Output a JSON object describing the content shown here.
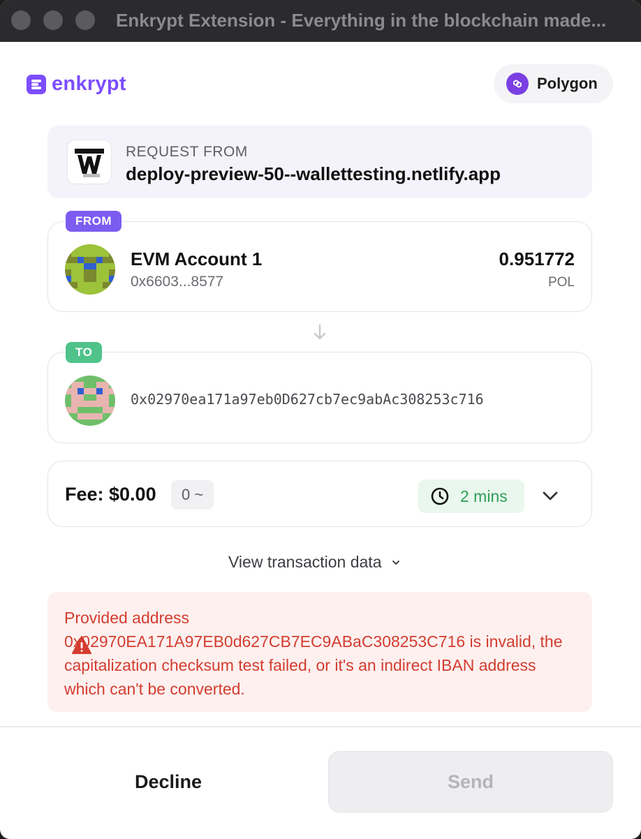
{
  "window": {
    "title": "Enkrypt Extension - Everything in the blockchain made..."
  },
  "header": {
    "logo_text": "enkrypt",
    "network": {
      "name": "Polygon",
      "icon": "polygon-icon"
    }
  },
  "request": {
    "label": "REQUEST FROM",
    "url": "deploy-preview-50--wallettesting.netlify.app",
    "icon": "site-w-icon"
  },
  "from": {
    "tag": "FROM",
    "account_name": "EVM Account 1",
    "address": "0x6603...8577",
    "balance": "0.951772",
    "unit": "POL"
  },
  "to": {
    "tag": "TO",
    "address": "0x02970ea171a97eb0D627cb7ec9abAc308253c716"
  },
  "fee": {
    "label": "Fee: $0.00",
    "native_amount": "0 ~",
    "time": "2 mins"
  },
  "view_tx_label": "View transaction data",
  "error": {
    "message": "Provided address 0x02970EA171A97EB0d627CB7EC9ABaC308253C716 is invalid, the capitalization checksum test failed, or it's an indirect IBAN address which can't be converted."
  },
  "buttons": {
    "decline": "Decline",
    "send": "Send"
  },
  "colors": {
    "brand": "#7c4dff",
    "from_tag": "#7c5cf0",
    "to_tag": "#4fc38a",
    "error_text": "#d33d2f",
    "time_text": "#2f9e56"
  }
}
